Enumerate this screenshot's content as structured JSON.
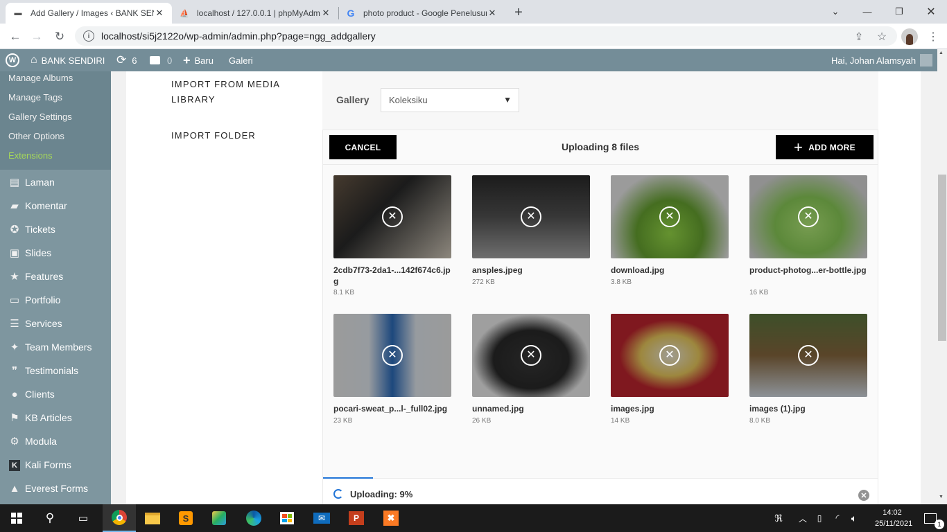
{
  "browser": {
    "tabs": [
      {
        "title": "Add Gallery / Images ‹ BANK SENDIRI",
        "icon": "wordpress-icon",
        "active": true
      },
      {
        "title": "localhost / 127.0.0.1 | phpMyAdmin",
        "icon": "phpmyadmin-icon",
        "active": false
      },
      {
        "title": "photo product - Google Penelusuran",
        "icon": "google-icon",
        "active": false
      }
    ],
    "new_tab": "+",
    "address": "localhost/si5j2122o/wp-admin/admin.php?page=ngg_addgallery"
  },
  "adminbar": {
    "site_name": "BANK SENDIRI",
    "updates_count": "6",
    "comments_count": "0",
    "new_label": "Baru",
    "galeri_label": "Galeri",
    "greeting": "Hai, Johan Alamsyah"
  },
  "sidebar": {
    "submenu": [
      "Manage Albums",
      "Manage Tags",
      "Gallery Settings",
      "Other Options",
      "Extensions"
    ],
    "items": [
      {
        "label": "Laman",
        "icon": "page-icon"
      },
      {
        "label": "Komentar",
        "icon": "comment-icon"
      },
      {
        "label": "Tickets",
        "icon": "lifebuoy-icon"
      },
      {
        "label": "Slides",
        "icon": "images-icon"
      },
      {
        "label": "Features",
        "icon": "star-icon"
      },
      {
        "label": "Portfolio",
        "icon": "folder-icon"
      },
      {
        "label": "Services",
        "icon": "list-icon"
      },
      {
        "label": "Team Members",
        "icon": "person-icon"
      },
      {
        "label": "Testimonials",
        "icon": "quote-icon"
      },
      {
        "label": "Clients",
        "icon": "users-icon"
      },
      {
        "label": "KB Articles",
        "icon": "book-icon"
      },
      {
        "label": "Modula",
        "icon": "gear-icon"
      },
      {
        "label": "Kali Forms",
        "icon": "k-icon"
      },
      {
        "label": "Everest Forms",
        "icon": "form-icon"
      }
    ]
  },
  "import_nav": {
    "media_library_line1": "IMPORT FROM MEDIA",
    "media_library_line2": "LIBRARY",
    "folder": "IMPORT FOLDER"
  },
  "gallery": {
    "label": "Gallery",
    "selected": "Koleksiku"
  },
  "uploader": {
    "cancel_label": "CANCEL",
    "title": "Uploading 8 files",
    "add_more_label": "ADD MORE",
    "files": [
      {
        "name": "2cdb7f73-2da1-...142f674c6.jpg",
        "size": "8.1 KB",
        "color": "#5a5045"
      },
      {
        "name": "ansples.jpeg",
        "size": "272 KB",
        "color": "#3a3a3a"
      },
      {
        "name": "download.jpg",
        "size": "3.8 KB",
        "color": "#7fbf3f"
      },
      {
        "name": "product-photog...er-bottle.jpg",
        "size": "16 KB",
        "color": "#8fcf6f"
      },
      {
        "name": "pocari-sweat_p...l-_full02.jpg",
        "size": "23 KB",
        "color": "#cfd8e0"
      },
      {
        "name": "unnamed.jpg",
        "size": "26 KB",
        "color": "#4a4a4a"
      },
      {
        "name": "images.jpg",
        "size": "14 KB",
        "color": "#b5202a"
      },
      {
        "name": "images (1).jpg",
        "size": "8.0 KB",
        "color": "#4f6040"
      }
    ],
    "progress_text": "Uploading: 9%",
    "progress": 0.09
  },
  "taskbar": {
    "time": "14:02",
    "date": "25/11/2021",
    "notification_count": "1"
  }
}
